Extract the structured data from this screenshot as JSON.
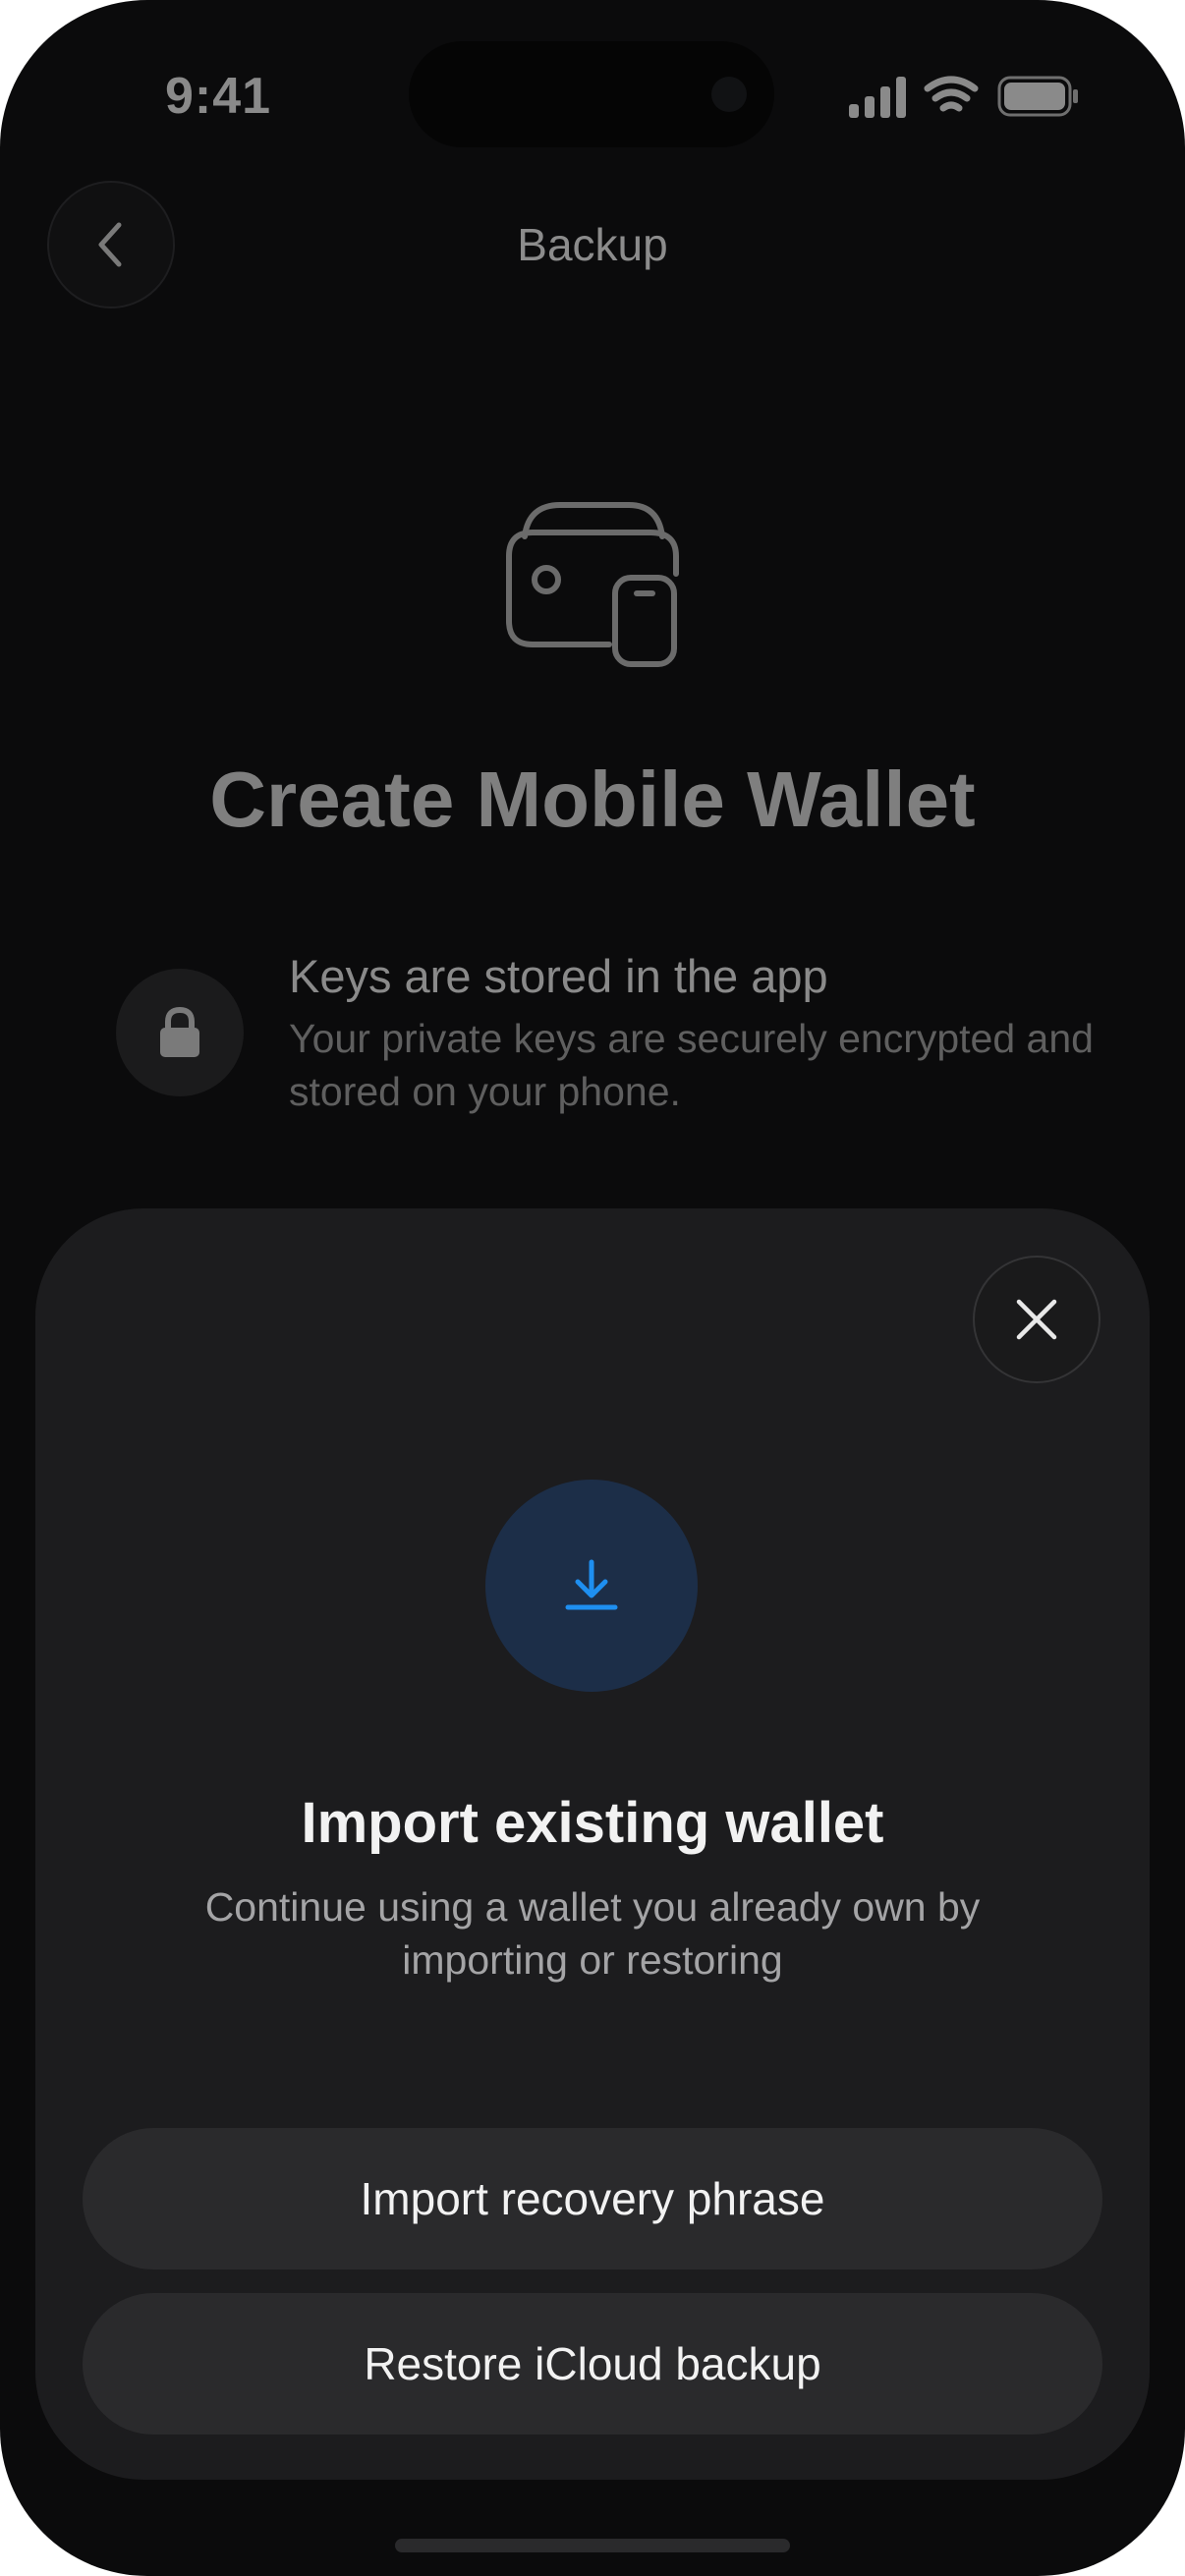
{
  "status_bar": {
    "time": "9:41"
  },
  "header": {
    "title": "Backup",
    "back_icon": "chevron-left-icon"
  },
  "hero": {
    "icon": "wallet-phone-icon",
    "title": "Create Mobile Wallet"
  },
  "feature": {
    "icon": "lock-icon",
    "title": "Keys are stored in the app",
    "description": "Your private keys are securely encrypted and stored on your phone."
  },
  "sheet": {
    "close_icon": "close-icon",
    "icon": "download-icon",
    "title": "Import existing wallet",
    "description": "Continue using a wallet you already own by importing or restoring",
    "buttons": {
      "import_label": "Import recovery phrase",
      "restore_label": "Restore iCloud backup"
    }
  },
  "colors": {
    "background": "#0b0b0c",
    "sheet": "#1c1c1e",
    "button": "#2a2a2c",
    "accent": "#1e8ff0",
    "accent_bg": "#1c2e48"
  }
}
